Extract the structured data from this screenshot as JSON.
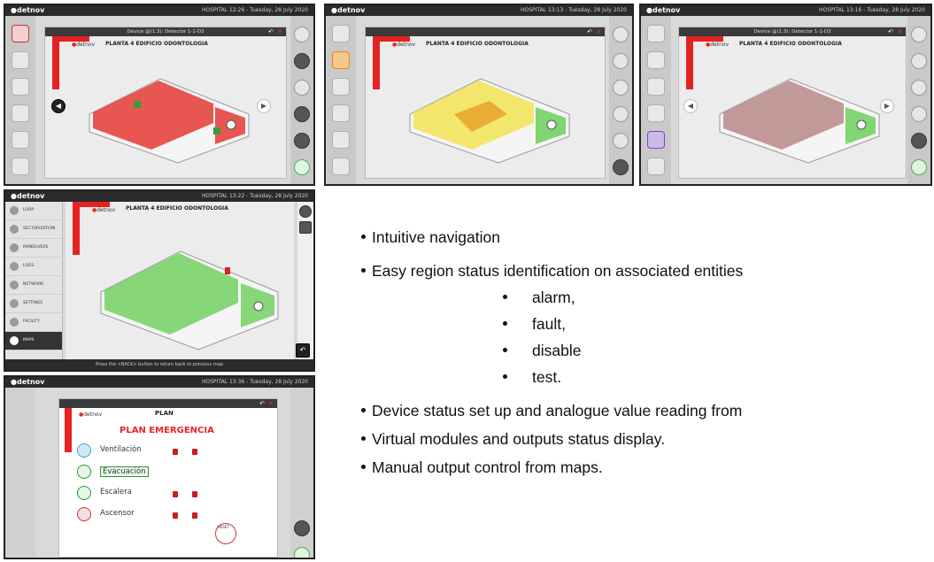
{
  "brand": {
    "logo": "detnov",
    "logo_prefix": "●"
  },
  "screens": {
    "s1": {
      "header": "HOSPITAL 12:26 - Tuesday, 28 July 2020",
      "device": "Device @(1.3): Detector 1-1-D3",
      "map_title": "PLANTA 4 EDIFICIO ODONTOLOGIA"
    },
    "s2": {
      "header": "HOSPITAL 13:13 - Tuesday, 28 July 2020",
      "map_title": "PLANTA 4 EDIFICIO ODONTOLOGIA"
    },
    "s3": {
      "header": "HOSPITAL 13:16 - Tuesday, 28 July 2020",
      "device": "Device @(1.3): Detector 1-1-D3",
      "map_title": "PLANTA 4 EDIFICIO ODONTOLOGIA"
    },
    "s4": {
      "header": "HOSPITAL 13:22 - Tuesday, 28 July 2020",
      "map_title": "PLANTA 4 EDIFICIO ODONTOLOGIA",
      "menu": [
        "LOOP",
        "SECTORIZATION",
        "MANEUVERS",
        "LOGS",
        "NETWORK",
        "SETTINGS",
        "FACILITY",
        "MAPS"
      ],
      "footer": "Press the <BACK> button to return back to previous map"
    },
    "s5": {
      "header": "HOSPITAL 13:36 - Tuesday, 28 July 2020",
      "plan_label": "PLAN",
      "plan_title": "PLAN EMERGENCIA",
      "rows": [
        "Ventilación",
        "Evacuación",
        "Escalera",
        "Ascensor"
      ],
      "reset": "RESET"
    }
  },
  "features": {
    "items": [
      "Intuitive navigation",
      "Easy region status identification on associated entities",
      "Device status set up and analogue value reading from",
      "Virtual modules and outputs status display.",
      "Manual output control from maps."
    ],
    "sub_items": [
      "alarm,",
      "fault,",
      "disable",
      "test."
    ]
  },
  "colors": {
    "alarm": "#e53935",
    "fault": "#f3e24a",
    "disable": "#b07a7a",
    "ok": "#6ccf5a",
    "brand_red": "#e52222"
  }
}
